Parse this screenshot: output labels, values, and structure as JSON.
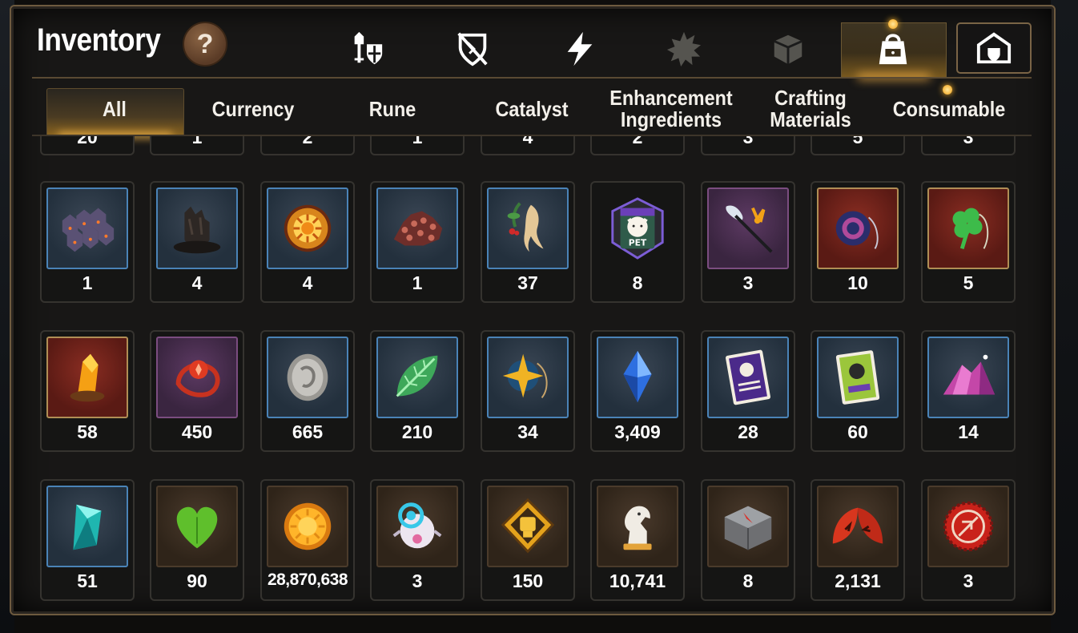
{
  "title": "Inventory",
  "help_label": "?",
  "category_tabs": [
    {
      "name": "equipment",
      "icon": "knight-shield-icon",
      "active": false
    },
    {
      "name": "broken-shield",
      "icon": "broken-shield-icon",
      "active": false
    },
    {
      "name": "power",
      "icon": "lightning-icon",
      "active": false
    },
    {
      "name": "burst",
      "icon": "spiky-burst-icon",
      "active": false
    },
    {
      "name": "box",
      "icon": "box-icon",
      "active": false
    },
    {
      "name": "bag",
      "icon": "bag-icon",
      "active": true
    },
    {
      "name": "guild",
      "icon": "guild-house-icon",
      "active": false
    }
  ],
  "sub_tabs": [
    {
      "label": "All",
      "active": true
    },
    {
      "label": "Currency"
    },
    {
      "label": "Rune"
    },
    {
      "label": "Catalyst"
    },
    {
      "label": "Enhancement\nIngredients"
    },
    {
      "label": "Crafting\nMaterials"
    },
    {
      "label": "Consumable"
    }
  ],
  "partial_row_quantities": [
    "20",
    "1",
    "2",
    "1",
    "4",
    "2",
    "3",
    "5",
    "3"
  ],
  "items": [
    {
      "icon": "dark-gem-cluster-icon",
      "frame": "blue",
      "qty": "1"
    },
    {
      "icon": "melted-stone-icon",
      "frame": "blue",
      "qty": "4"
    },
    {
      "icon": "sun-medallion-icon",
      "frame": "blue",
      "qty": "4"
    },
    {
      "icon": "red-crystal-icon",
      "frame": "blue",
      "qty": "1"
    },
    {
      "icon": "ginseng-root-icon",
      "frame": "blue",
      "qty": "37"
    },
    {
      "icon": "pet-food-bag-icon",
      "frame": "pet",
      "qty": "8",
      "badge": "PET"
    },
    {
      "icon": "feather-wand-icon",
      "frame": "purple",
      "qty": "3"
    },
    {
      "icon": "pendant-icon",
      "frame": "red",
      "qty": "10"
    },
    {
      "icon": "clover-pendant-icon",
      "frame": "red",
      "qty": "5"
    },
    {
      "icon": "amber-crystal-icon",
      "frame": "red",
      "qty": "58"
    },
    {
      "icon": "red-rune-ring-icon",
      "frame": "purple",
      "qty": "450"
    },
    {
      "icon": "silver-coin-icon",
      "frame": "blue",
      "qty": "665"
    },
    {
      "icon": "green-leaf-icon",
      "frame": "blue",
      "qty": "210"
    },
    {
      "icon": "star-pendant-icon",
      "frame": "blue",
      "qty": "34"
    },
    {
      "icon": "blue-crystal-icon",
      "frame": "blue",
      "qty": "3,409"
    },
    {
      "icon": "purple-card-icon",
      "frame": "blue",
      "qty": "28"
    },
    {
      "icon": "green-card-icon",
      "frame": "blue",
      "qty": "60"
    },
    {
      "icon": "pink-crystal-pile-icon",
      "frame": "blue",
      "qty": "14"
    },
    {
      "icon": "cyan-crystal-icon",
      "frame": "blue",
      "qty": "51"
    },
    {
      "icon": "green-heart-icon",
      "frame": "brown",
      "qty": "90"
    },
    {
      "icon": "gold-coin-icon",
      "frame": "brown",
      "qty": "28,870,638"
    },
    {
      "icon": "robot-orb-icon",
      "frame": "brown",
      "qty": "3"
    },
    {
      "icon": "fist-emblem-icon",
      "frame": "brown",
      "qty": "150"
    },
    {
      "icon": "chess-knight-icon",
      "frame": "brown",
      "qty": "10,741"
    },
    {
      "icon": "stone-cube-icon",
      "frame": "brown",
      "qty": "8"
    },
    {
      "icon": "red-leaves-icon",
      "frame": "brown",
      "qty": "2,131"
    },
    {
      "icon": "red-seal-icon",
      "frame": "brown",
      "qty": "3"
    }
  ],
  "colors": {
    "accent_gold": "#ffb84a",
    "frame_blue": "#4a83b7",
    "frame_brown": "#4b3b2b",
    "text": "#ffffff"
  }
}
